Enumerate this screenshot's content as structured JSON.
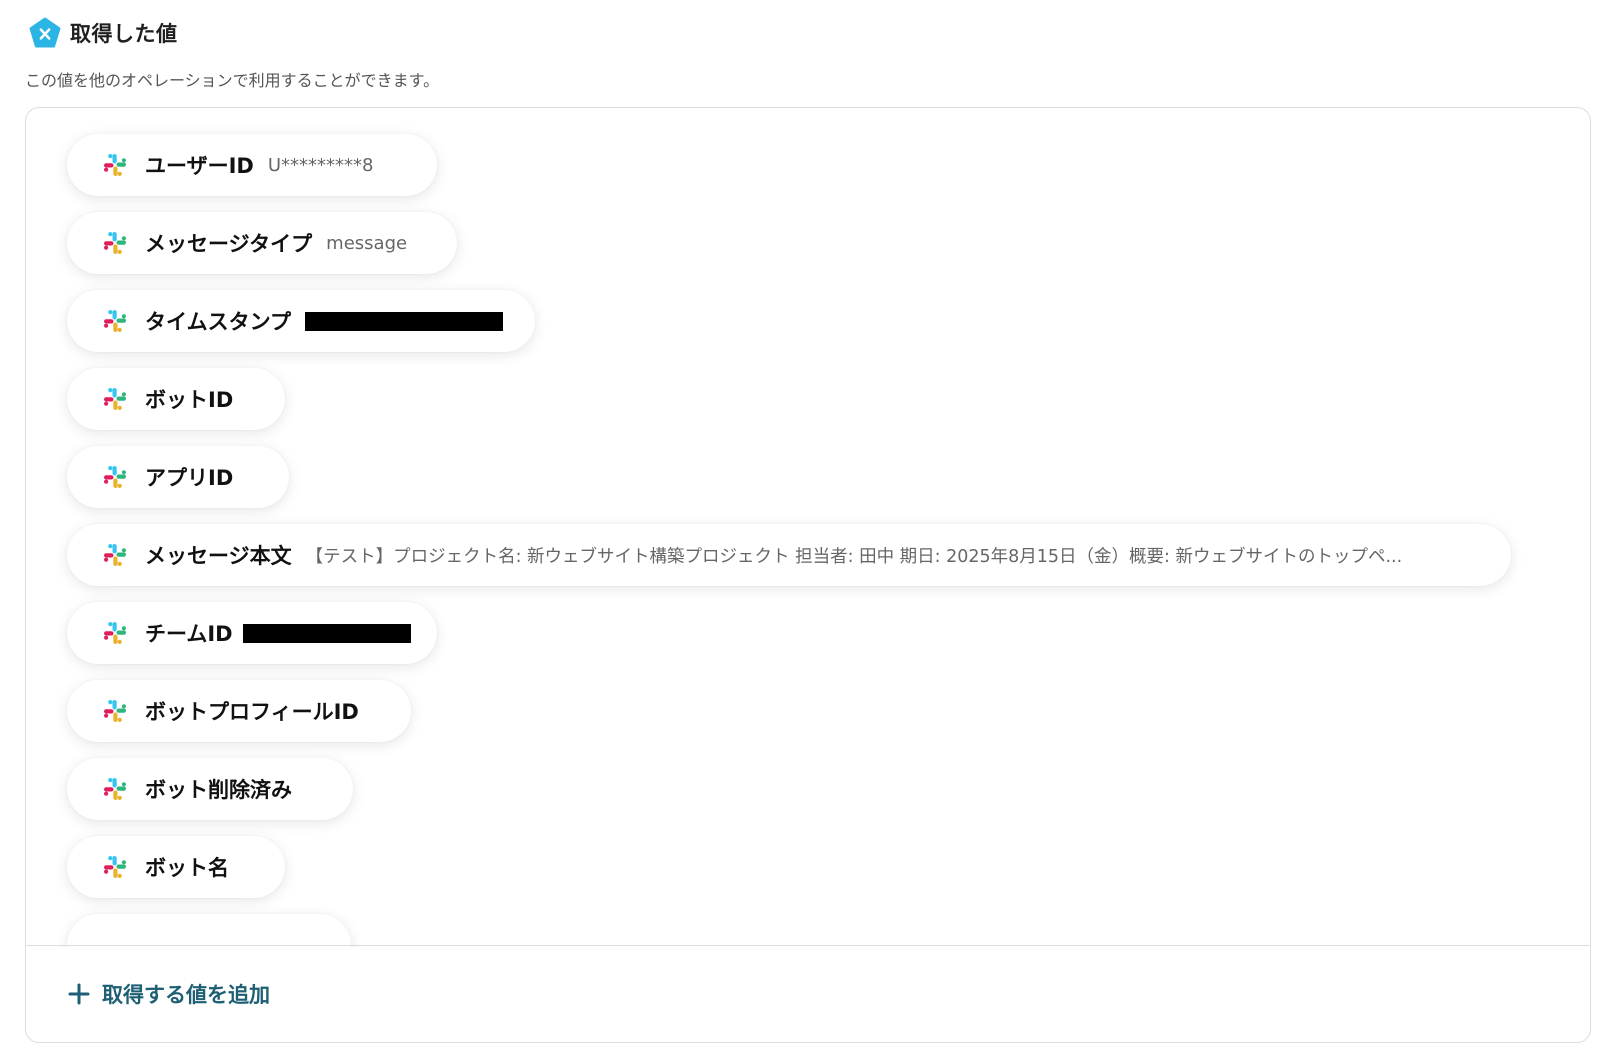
{
  "header": {
    "icon": "x-variable-icon",
    "icon_color": "#2bb5e5",
    "title": "取得した値"
  },
  "subtitle": "この値を他のオペレーションで利用することができます。",
  "items": [
    {
      "label": "ユーザーID",
      "value": "U*********8",
      "redacted": false
    },
    {
      "label": "メッセージタイプ",
      "value": "message",
      "redacted": false
    },
    {
      "label": "タイムスタンプ",
      "value": "",
      "redacted": true
    },
    {
      "label": "ボットID",
      "value": "",
      "redacted": false
    },
    {
      "label": "アプリID",
      "value": "",
      "redacted": false
    },
    {
      "label": "メッセージ本文",
      "value": "【テスト】プロジェクト名: 新ウェブサイト構築プロジェクト 担当者: 田中 期日: 2025年8月15日（金）概要: 新ウェブサイトのトップペ...",
      "redacted": false
    },
    {
      "label": "チームID",
      "value": "",
      "redacted": true
    },
    {
      "label": "ボットプロフィールID",
      "value": "",
      "redacted": false
    },
    {
      "label": "ボット削除済み",
      "value": "",
      "redacted": false
    },
    {
      "label": "ボット名",
      "value": "",
      "redacted": false
    }
  ],
  "item_icon": "slack-icon",
  "footer": {
    "add_label": "取得する値を追加",
    "add_icon": "plus-icon",
    "accent_color": "#1e5f74"
  }
}
